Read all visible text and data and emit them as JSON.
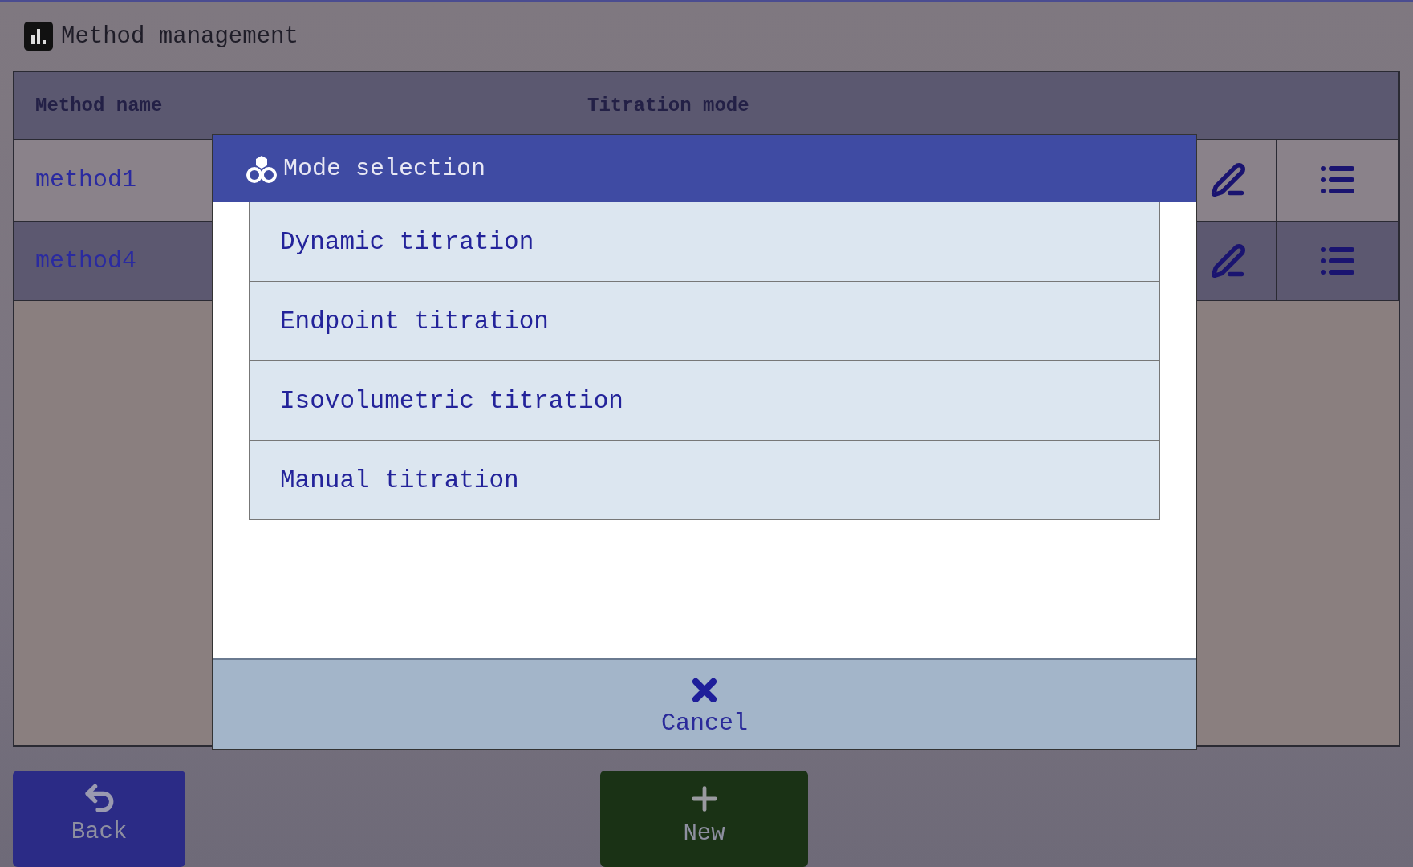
{
  "header": {
    "title": "Method management"
  },
  "table": {
    "columns": [
      "Method name",
      "Titration mode"
    ],
    "rows": [
      {
        "method_name": "method1"
      },
      {
        "method_name": "method4"
      }
    ]
  },
  "dialog": {
    "title": "Mode selection",
    "options": [
      "Dynamic titration",
      "Endpoint titration",
      "Isovolumetric titration",
      "Manual titration"
    ],
    "cancel": "Cancel"
  },
  "buttons": [
    {
      "kind": "back",
      "label": "Back"
    },
    {
      "kind": "new",
      "label": "New"
    }
  ]
}
